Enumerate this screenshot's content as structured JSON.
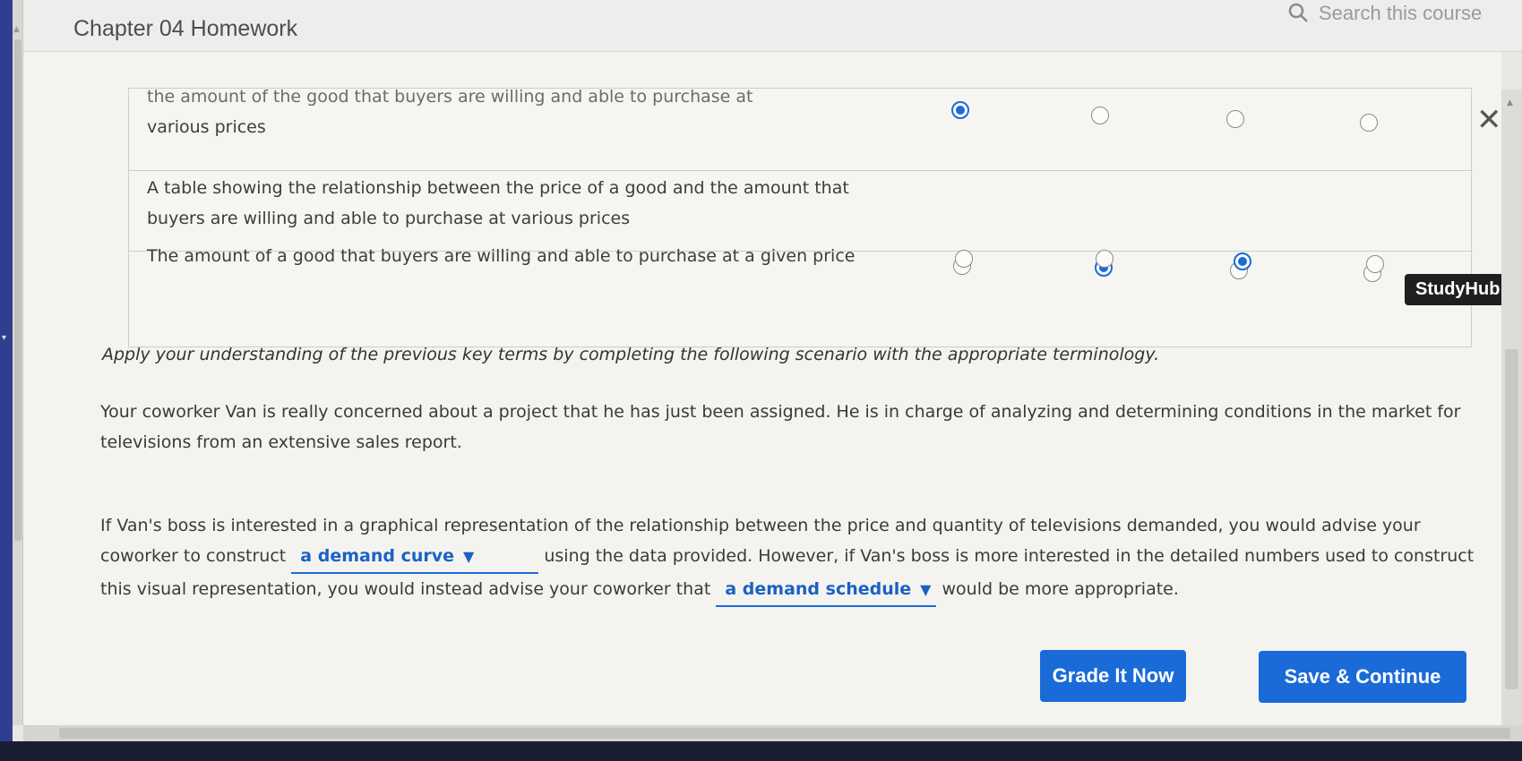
{
  "header": {
    "title": "Chapter 04 Homework",
    "search_placeholder": "Search this course"
  },
  "matching_table": {
    "rows": [
      {
        "text_clipped": "the amount of the good that buyers are willing and able to purchase at",
        "text": "various prices",
        "selected_column": 1
      },
      {
        "text": "A table showing the relationship between the price of a good and the amount that buyers are willing and able to purchase at various prices",
        "selected_column": 2
      },
      {
        "text": "The amount of a good that buyers are willing and able to purchase at a given price",
        "selected_column": 3
      }
    ]
  },
  "badge": "StudyHub",
  "instruction": "Apply your understanding of the previous key terms by completing the following scenario with the appropriate terminology.",
  "scenario": {
    "paragraph1": "Your coworker Van is really concerned about a project that he has just been assigned. He is in charge of analyzing and determining conditions in the market for televisions from an extensive sales report.",
    "p2_part1": "If Van's boss is interested in a graphical representation of the relationship between the price and quantity of televisions demanded, you would advise your coworker to construct",
    "dropdown1_value": "a demand curve",
    "p2_part2": "using the data provided. However, if Van's boss is more interested in the detailed numbers used to construct this visual representation, you would instead advise your coworker that",
    "dropdown2_value": "a demand schedule",
    "p2_part3": "would be more appropriate."
  },
  "buttons": {
    "grade": "Grade It Now",
    "save": "Save & Continue"
  },
  "colors": {
    "accent": "#1a6bd8",
    "badge_bg": "#1f1f1f"
  }
}
